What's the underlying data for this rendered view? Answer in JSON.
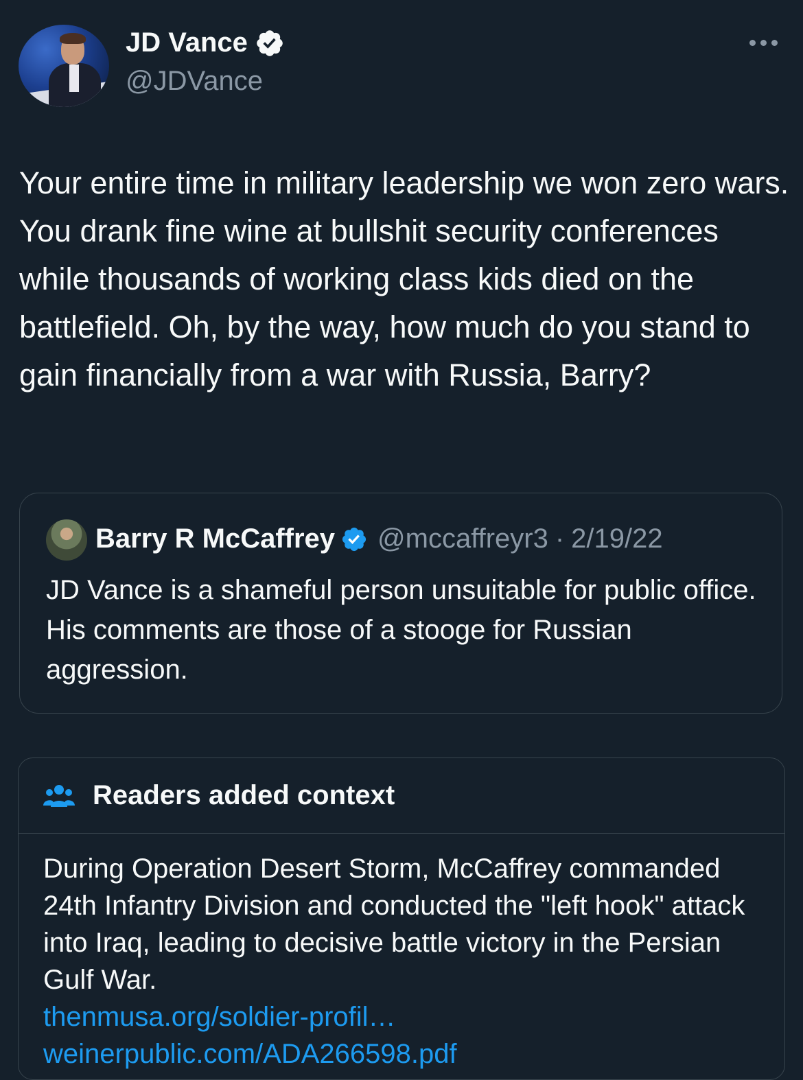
{
  "author": {
    "name": "JD Vance",
    "handle": "@JDVance"
  },
  "tweet": {
    "text": "Your entire time in military leadership we won zero wars. You drank fine wine at bullshit security conferences while thousands of working class kids died on the battlefield. Oh, by the way, how much do you stand to gain financially from a war with Russia, Barry?"
  },
  "quoted_tweet": {
    "name": "Barry R McCaffrey",
    "handle": "@mccaffreyr3",
    "separator": "·",
    "date": "2/19/22",
    "text": "JD Vance is a shameful person unsuitable for public office. His comments are those of a stooge for Russian aggression."
  },
  "context_note": {
    "title": "Readers added context",
    "text": "During Operation Desert Storm, McCaffrey commanded 24th Infantry Division and conducted the \"left hook\" attack into Iraq, leading to decisive battle victory in the Persian Gulf War.",
    "links": [
      "thenmusa.org/soldier-profil…",
      "weinerpublic.com/ADA266598.pdf"
    ]
  },
  "colors": {
    "background": "#15202b",
    "text": "#f7f9f9",
    "secondary_text": "#8b98a5",
    "link": "#1d9bf0",
    "border": "#38444d"
  },
  "icons": [
    "verified-badge-icon",
    "more-options-icon",
    "readers-context-icon"
  ]
}
